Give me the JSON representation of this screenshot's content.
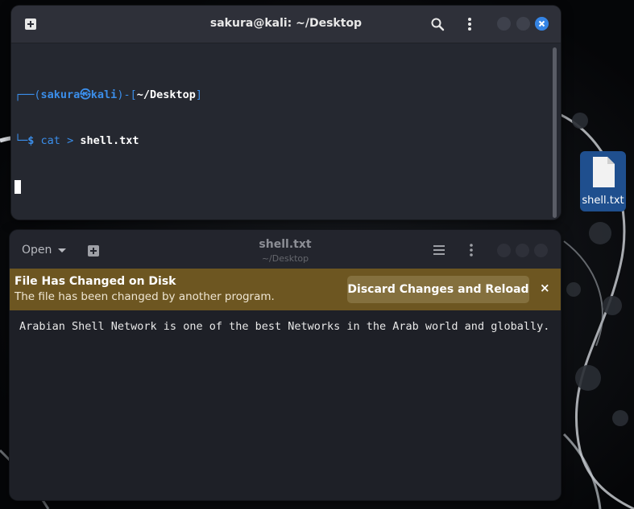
{
  "terminal": {
    "title": "sakura@kali: ~/Desktop",
    "prompt": {
      "open": "┌──(",
      "user": "sakura",
      "at_symbol": "㉿",
      "host": "kali",
      "mid": ")-[",
      "path": "~/Desktop",
      "close": "]",
      "corner": "└─",
      "dollar": "$",
      "command": "cat",
      "redirect": ">",
      "argument": "shell.txt"
    },
    "icons": [
      "new-tab-icon",
      "search-icon",
      "kebab-menu-icon",
      "minimize-icon",
      "maximize-icon",
      "close-icon"
    ]
  },
  "desktop": {
    "file_label": "shell.txt"
  },
  "editor": {
    "open_label": "Open",
    "title": "shell.txt",
    "subtitle": "~/Desktop",
    "infobar": {
      "title": "File Has Changed on Disk",
      "message": "The file has been changed by another program.",
      "button": "Discard Changes and Reload",
      "close": "×"
    },
    "content": "Arabian Shell Network is one of the best Networks in the Arab world and globally."
  },
  "colors": {
    "accent": "#3584e4",
    "infobar": "#6d5621",
    "prompt_blue": "#3b8eea"
  }
}
